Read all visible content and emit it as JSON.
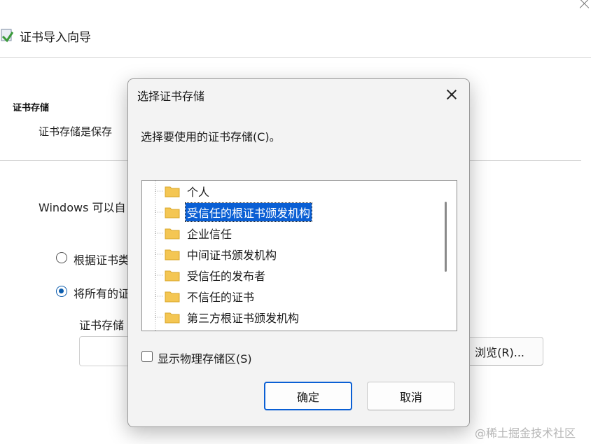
{
  "wizard": {
    "title": "证书导入向导",
    "section_title": "证书存储",
    "section_desc": "证书存储是保存",
    "windows_text": "Windows 可以自",
    "radio_auto_label": "根据证书类",
    "radio_all_label": "将所有的证",
    "store_label": "证书存储",
    "browse_label": "浏览(R)..."
  },
  "dialog": {
    "title": "选择证书存储",
    "prompt": "选择要使用的证书存储(C)。",
    "stores": [
      {
        "label": "个人",
        "selected": false
      },
      {
        "label": "受信任的根证书颁发机构",
        "selected": true
      },
      {
        "label": "企业信任",
        "selected": false
      },
      {
        "label": "中间证书颁发机构",
        "selected": false
      },
      {
        "label": "受信任的发布者",
        "selected": false
      },
      {
        "label": "不信任的证书",
        "selected": false
      },
      {
        "label": "第三方根证书颁发机构",
        "selected": false
      }
    ],
    "show_physical_label": "显示物理存储区(S)",
    "show_physical_checked": false,
    "ok_label": "确定",
    "cancel_label": "取消"
  },
  "watermark": "@稀土掘金技术社区",
  "colors": {
    "selection": "#0a5fd4",
    "radio_accent": "#0b5cad",
    "folder": "#f4c653"
  }
}
